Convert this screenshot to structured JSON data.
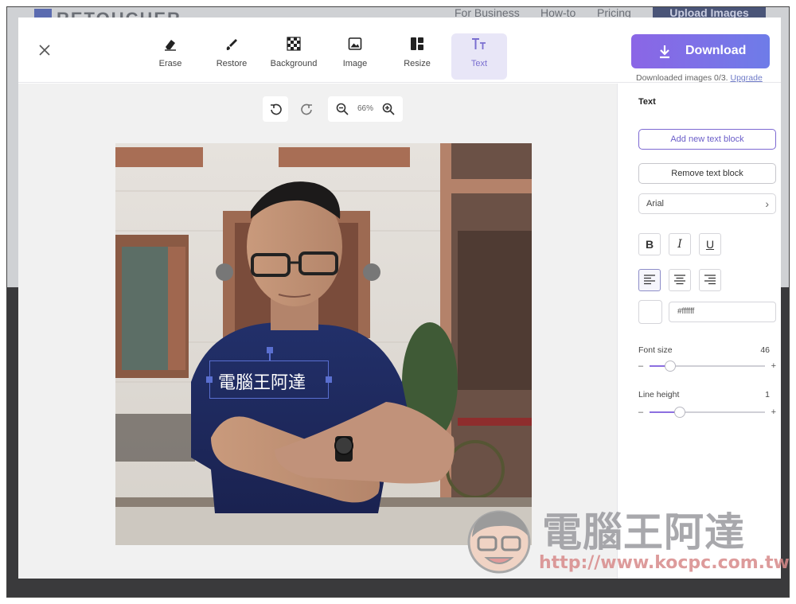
{
  "site": {
    "brand": "RETOUCHER",
    "nav": [
      "For Business",
      "How-to",
      "Pricing"
    ],
    "upload_label": "Upload Images"
  },
  "toolbar": {
    "tools": [
      {
        "label": "Erase",
        "icon": "eraser-icon"
      },
      {
        "label": "Restore",
        "icon": "brush-icon"
      },
      {
        "label": "Background",
        "icon": "checkerboard-icon"
      },
      {
        "label": "Image",
        "icon": "image-icon"
      },
      {
        "label": "Resize",
        "icon": "layout-icon"
      },
      {
        "label": "Text",
        "icon": "text-icon",
        "active": true
      }
    ],
    "download_label": "Download",
    "download_count": "Downloaded images 0/3.",
    "upgrade_label": "Upgrade"
  },
  "canvas": {
    "zoom": "66%",
    "text_block": "電腦王阿達"
  },
  "panel": {
    "title": "Text",
    "add_label": "Add new text block",
    "remove_label": "Remove text block",
    "font": "Arial",
    "style_buttons": [
      "B",
      "I",
      "U"
    ],
    "color_hex": "#ffffff",
    "font_size_label": "Font size",
    "font_size_value": "46",
    "font_size_fraction": 0.18,
    "line_height_label": "Line height",
    "line_height_value": "1",
    "line_height_fraction": 0.26
  },
  "watermark": {
    "title": "電腦王阿達",
    "url": "http://www.kocpc.com.tw"
  },
  "colors": {
    "accent": "#7d69d2",
    "download_gradient_start": "#8b66e6",
    "download_gradient_end": "#6e7ce8"
  }
}
